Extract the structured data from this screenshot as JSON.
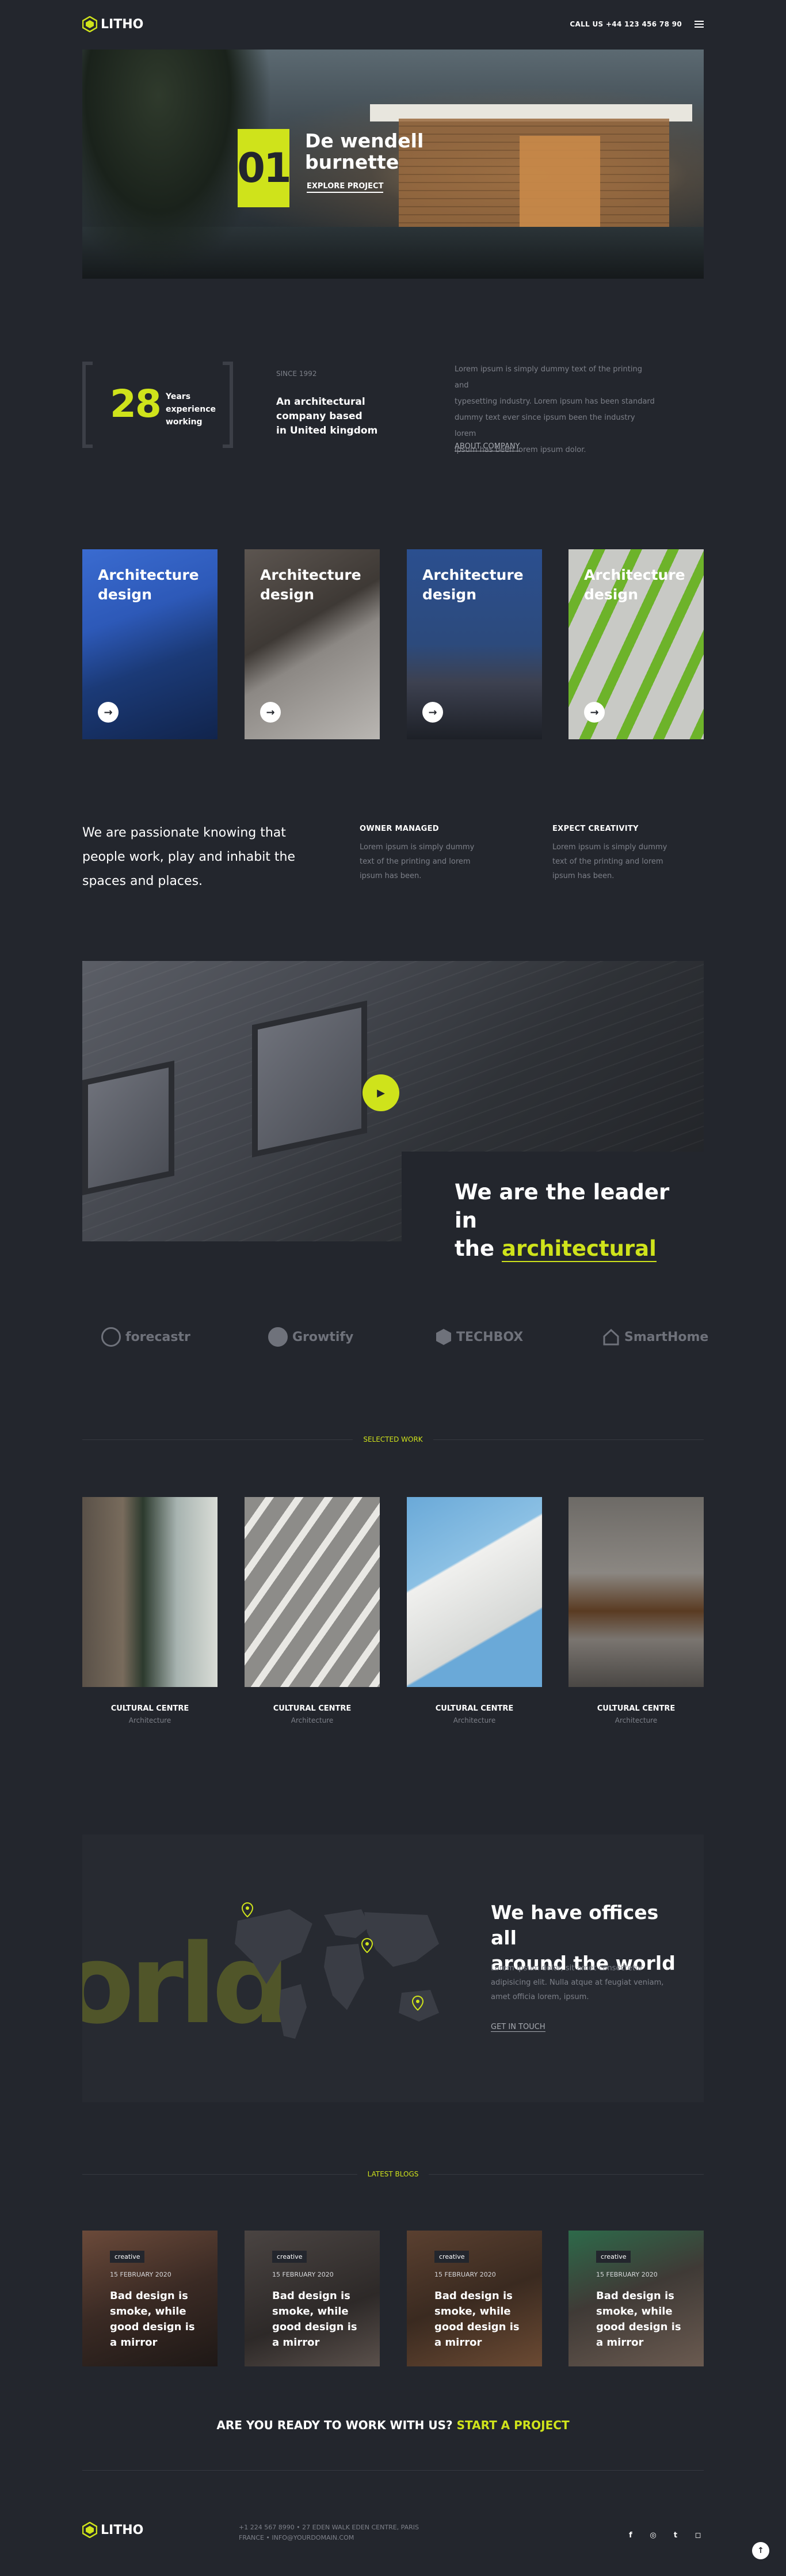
{
  "brand": {
    "name": "LITHO",
    "accent": "#cfe31b",
    "background": "#23262d"
  },
  "header": {
    "phone_label": "CALL US +44 123 456 78 90",
    "menu_icon": "hamburger-icon"
  },
  "hero": {
    "number": "01",
    "title_line1": "De wendell",
    "title_line2": "burnette",
    "button": "EXPLORE PROJECT"
  },
  "about": {
    "years": "28",
    "years_line1": "Years",
    "years_line2": "experience",
    "years_line3": "working",
    "since": "SINCE 1992",
    "title_line1": "An architectural",
    "title_line2": "company based",
    "title_line3": "in United kingdom",
    "text_line1": "Lorem ipsum is simply dummy text of the printing and",
    "text_line2": "typesetting industry. Lorem ipsum has been standard",
    "text_line3": "dummy text ever since ipsum been the industry lorem",
    "text_line4": "ipsum has been lorem ipsum dolor.",
    "link": "ABOUT COMPANY"
  },
  "services": [
    {
      "line1": "Architecture",
      "line2": "design",
      "icon": "arrow-right-icon"
    },
    {
      "line1": "Architecture",
      "line2": "design",
      "icon": "arrow-right-icon"
    },
    {
      "line1": "Architecture",
      "line2": "design",
      "icon": "arrow-right-icon"
    },
    {
      "line1": "Architecture",
      "line2": "design",
      "icon": "arrow-right-icon"
    }
  ],
  "mission": {
    "line1": "We are passionate knowing that",
    "line2": "people work, play and inhabit the",
    "line3": "spaces and places.",
    "features": [
      {
        "title": "OWNER MANAGED",
        "line1": "Lorem ipsum is simply dummy",
        "line2": "text of the printing and lorem",
        "line3": "ipsum has been."
      },
      {
        "title": "EXPECT CREATIVITY",
        "line1": "Lorem ipsum is simply dummy",
        "line2": "text of the printing and lorem",
        "line3": "ipsum has been."
      }
    ]
  },
  "video": {
    "play_icon": "play-icon"
  },
  "leader": {
    "line1": "We are the leader in",
    "line2_prefix": "the",
    "line2_highlight": "architectural"
  },
  "clients": [
    "forecastr",
    "Growtify",
    "TECHBOX",
    "SmartHome"
  ],
  "works": {
    "heading": "SELECTED WORK",
    "items": [
      {
        "title": "CULTURAL CENTRE",
        "category": "Architecture"
      },
      {
        "title": "CULTURAL CENTRE",
        "category": "Architecture"
      },
      {
        "title": "CULTURAL CENTRE",
        "category": "Architecture"
      },
      {
        "title": "CULTURAL CENTRE",
        "category": "Architecture"
      }
    ]
  },
  "offices": {
    "bigword": "orld",
    "title_line1": "We have offices all",
    "title_line2": "around the world",
    "text_line1": "Lorem ipsum dolor, sit amet consectetur",
    "text_line2": "adipisicing elit. Nulla atque at feugiat veniam,",
    "text_line3": "amet officia lorem, ipsum.",
    "link": "GET IN TOUCH",
    "pin_icon": "map-pin-icon"
  },
  "blogs": {
    "heading": "LATEST BLOGS",
    "items": [
      {
        "tag": "creative",
        "date": "15 FEBRUARY 2020",
        "line1": "Bad design is",
        "line2": "smoke, while",
        "line3": "good design is",
        "line4": "a mirror"
      },
      {
        "tag": "creative",
        "date": "15 FEBRUARY 2020",
        "line1": "Bad design is",
        "line2": "smoke, while",
        "line3": "good design is",
        "line4": "a mirror"
      },
      {
        "tag": "creative",
        "date": "15 FEBRUARY 2020",
        "line1": "Bad design is",
        "line2": "smoke, while",
        "line3": "good design is",
        "line4": "a mirror"
      },
      {
        "tag": "creative",
        "date": "15 FEBRUARY 2020",
        "line1": "Bad design is",
        "line2": "smoke, while",
        "line3": "good design is",
        "line4": "a mirror"
      }
    ]
  },
  "cta": {
    "text": "ARE YOU READY TO WORK WITH US?",
    "link": "START A PROJECT"
  },
  "footer": {
    "logo": "LITHO",
    "address_line1": "+1 224 567 8990 • 27 EDEN WALK EDEN CENTRE, PARIS",
    "address_line2": "FRANCE • INFO@YOURDOMAIN.COM",
    "social": [
      {
        "name": "facebook-icon",
        "glyph": "f"
      },
      {
        "name": "dribbble-icon",
        "glyph": "◎"
      },
      {
        "name": "twitter-icon",
        "glyph": "t"
      },
      {
        "name": "instagram-icon",
        "glyph": "◻"
      }
    ],
    "to_top_icon": "arrow-up-icon"
  }
}
